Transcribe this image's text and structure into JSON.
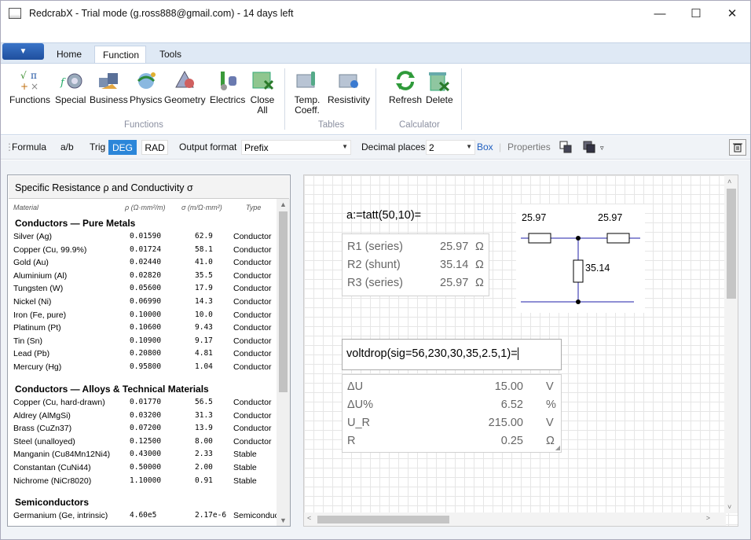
{
  "window": {
    "title": "RedcrabX  -  Trial mode (g.ross888@gmail.com) - 14 days left",
    "controls": [
      "minimize",
      "maximize",
      "close"
    ]
  },
  "ribbon": {
    "tabs": [
      "Home",
      "Function",
      "Tools"
    ],
    "active_tab": "Function",
    "groups": [
      {
        "label": "Functions",
        "buttons": [
          "Functions",
          "Special",
          "Business",
          "Physics",
          "Geometry",
          "Electrics",
          "Close All"
        ]
      },
      {
        "label": "Tables",
        "buttons": [
          "Temp. Coeff.",
          "Resistivity"
        ]
      },
      {
        "label": "Calculator",
        "buttons": [
          "Refresh",
          "Delete"
        ]
      }
    ]
  },
  "toolbar": {
    "formula": "Formula",
    "ab": "a/b",
    "trig": "Trig",
    "deg": "DEG",
    "rad": "RAD",
    "output_format_label": "Output format",
    "output_format_value": "Prefix",
    "decimal_places_label": "Decimal places",
    "decimal_places_value": "2",
    "box": "Box",
    "properties": "Properties"
  },
  "left_panel": {
    "title": "Specific Resistance ρ and Conductivity σ",
    "columns": [
      "Material",
      "ρ (Ω·mm²/m)",
      "σ (m/Ω·mm²)",
      "Type"
    ],
    "sections": [
      {
        "title": "Conductors — Pure Metals",
        "rows": [
          [
            "Silver (Ag)",
            "0.01590",
            "62.9",
            "Conductor"
          ],
          [
            "Copper (Cu, 99.9%)",
            "0.01724",
            "58.1",
            "Conductor"
          ],
          [
            "Gold (Au)",
            "0.02440",
            "41.0",
            "Conductor"
          ],
          [
            "Aluminium (Al)",
            "0.02820",
            "35.5",
            "Conductor"
          ],
          [
            "Tungsten (W)",
            "0.05600",
            "17.9",
            "Conductor"
          ],
          [
            "Nickel (Ni)",
            "0.06990",
            "14.3",
            "Conductor"
          ],
          [
            "Iron (Fe, pure)",
            "0.10000",
            "10.0",
            "Conductor"
          ],
          [
            "Platinum (Pt)",
            "0.10600",
            "9.43",
            "Conductor"
          ],
          [
            "Tin (Sn)",
            "0.10900",
            "9.17",
            "Conductor"
          ],
          [
            "Lead (Pb)",
            "0.20800",
            "4.81",
            "Conductor"
          ],
          [
            "Mercury (Hg)",
            "0.95800",
            "1.04",
            "Conductor"
          ]
        ]
      },
      {
        "title": "Conductors — Alloys & Technical Materials",
        "rows": [
          [
            "Copper (Cu, hard-drawn)",
            "0.01770",
            "56.5",
            "Conductor"
          ],
          [
            "Aldrey (AlMgSi)",
            "0.03200",
            "31.3",
            "Conductor"
          ],
          [
            "Brass (CuZn37)",
            "0.07200",
            "13.9",
            "Conductor"
          ],
          [
            "Steel (unalloyed)",
            "0.12500",
            "8.00",
            "Conductor"
          ],
          [
            "Manganin (Cu84Mn12Ni4)",
            "0.43000",
            "2.33",
            "Stable"
          ],
          [
            "Constantan (CuNi44)",
            "0.50000",
            "2.00",
            "Stable"
          ],
          [
            "Nichrome (NiCr8020)",
            "1.10000",
            "0.91",
            "Stable"
          ]
        ]
      },
      {
        "title": "Semiconductors",
        "rows": [
          [
            "Germanium (Ge, intrinsic)",
            "4.60e5",
            "2.17e-6",
            "Semiconductor"
          ]
        ]
      }
    ]
  },
  "canvas": {
    "formula1": "a:=tatt(50,10)=",
    "result1": [
      {
        "label": "R1 (series)",
        "value": "25.97",
        "unit": "Ω"
      },
      {
        "label": "R2 (shunt)",
        "value": "35.14",
        "unit": "Ω"
      },
      {
        "label": "R3 (series)",
        "value": "25.97",
        "unit": "Ω"
      }
    ],
    "circuit": {
      "r1": "25.97",
      "r3": "25.97",
      "r2": "35.14"
    },
    "formula2": "voltdrop(sig=56,230,30,35,2.5,1)=",
    "result2": [
      {
        "label": "ΔU",
        "value": "15.00",
        "unit": "V"
      },
      {
        "label": "ΔU%",
        "value": "6.52",
        "unit": "%"
      },
      {
        "label": "U_R",
        "value": "215.00",
        "unit": "V"
      },
      {
        "label": "R",
        "value": "0.25",
        "unit": "Ω"
      }
    ]
  },
  "colors": {
    "accent": "#2b86d9",
    "circuit_line": "#1f1fa8",
    "file_button": "#2a5fb5"
  }
}
